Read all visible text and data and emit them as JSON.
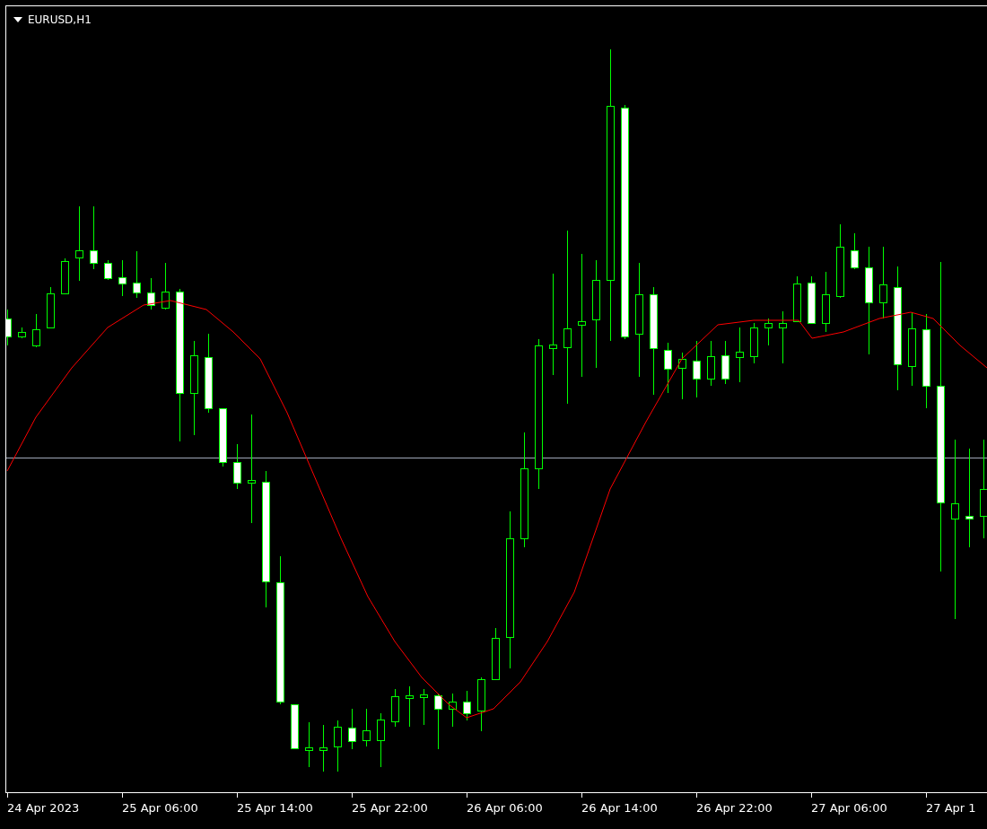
{
  "chart": {
    "title": "EURUSD,H1"
  },
  "time_axis": {
    "labels": [
      "24 Apr 2023",
      "25 Apr 06:00",
      "25 Apr 14:00",
      "25 Apr 22:00",
      "26 Apr 06:00",
      "26 Apr 14:00",
      "26 Apr 22:00",
      "27 Apr 06:00",
      "27 Apr 1"
    ]
  }
}
